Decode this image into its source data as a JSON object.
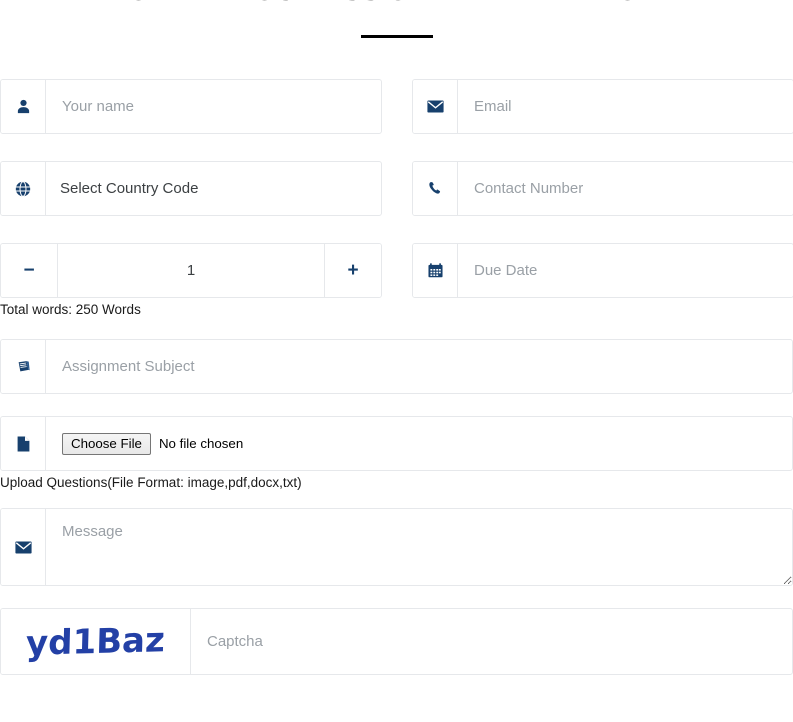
{
  "header": {
    "title": "ORDER YOUR ASSIGNMENT HELP NOW"
  },
  "form": {
    "name": {
      "icon": "user-icon",
      "placeholder": "Your name",
      "value": ""
    },
    "email": {
      "icon": "envelope-icon",
      "placeholder": "Email",
      "value": ""
    },
    "country_code": {
      "icon": "globe-icon",
      "selected": "Select Country Code",
      "options": [
        "Select Country Code"
      ]
    },
    "contact": {
      "icon": "phone-icon",
      "placeholder": "Contact Number",
      "value": ""
    },
    "pages": {
      "decrement_label": "−",
      "increment_label": "+",
      "value": "1",
      "helper": "Total words: 250 Words"
    },
    "due_date": {
      "icon": "calendar-icon",
      "placeholder": "Due Date",
      "value": ""
    },
    "subject": {
      "icon": "book-icon",
      "placeholder": "Assignment Subject",
      "value": ""
    },
    "upload": {
      "icon": "file-icon",
      "button_label": "Choose File",
      "status": "No file chosen",
      "helper": "Upload Questions(File Format: image,pdf,docx,txt)"
    },
    "message": {
      "icon": "envelope-icon",
      "placeholder": "Message",
      "value": ""
    },
    "captcha": {
      "image_text": "yd1Baz",
      "placeholder": "Captcha",
      "value": ""
    }
  },
  "colors": {
    "icon": "#17406d",
    "captcha_text": "#2340a6",
    "border": "#e6e8eb",
    "placeholder": "#9aa0a6",
    "heading": "#1a1a1a"
  }
}
